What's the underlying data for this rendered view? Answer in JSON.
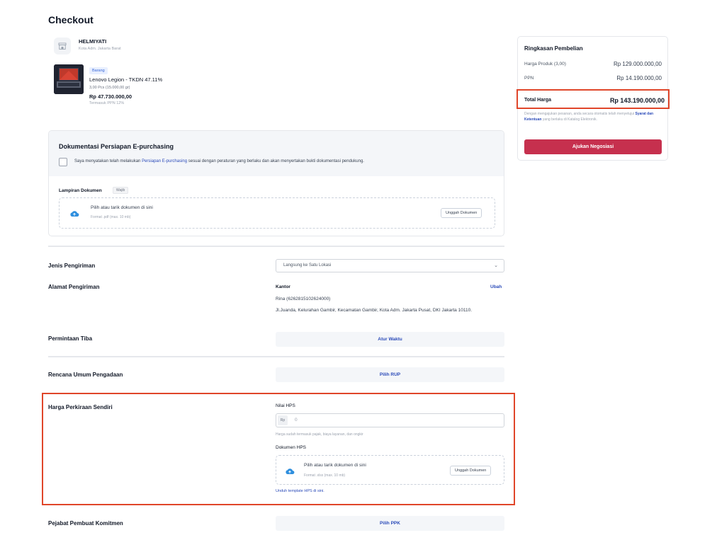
{
  "page": {
    "title": "Checkout"
  },
  "seller": {
    "name": "HELMIYATI",
    "city": "Kota Adm. Jakarta Barat",
    "icon": "store-icon"
  },
  "product": {
    "badge": "Barang",
    "name": "Lenovo Legion - TKDN 47.11%",
    "qty": "3,00 Pcs (15.000,00 gr)",
    "price": "Rp 47.730.000,00",
    "tax": "Termasuk PPN 12%"
  },
  "eproc": {
    "title": "Dokumentasi Persiapan E-purchasing",
    "check_prefix": "Saya menyatakan telah melakukan ",
    "check_link": "Persiapan E-purchasing",
    "check_suffix": " sesuai dengan peraturan yang berlaku dan akan menyertakan bukti dokumentasi pendukung.",
    "attachment_label": "Lampiran Dokumen",
    "required_badge": "Wajib",
    "dropzone_main": "Pilih atau tarik dokumen di sini",
    "dropzone_sub": "Format .pdf (max. 10 mb)",
    "upload_label": "Unggah Dokumen"
  },
  "shipping": {
    "type_label": "Jenis Pengiriman",
    "type_value": "Langsung ke Satu Lokasi",
    "address_label": "Alamat Pengiriman",
    "address_name": "Kantor",
    "address_change": "Ubah",
    "address_phone": "Rina (6262815102624000)",
    "address_line": "Jl.Juanda, Kelurahan Gambir, Kecamatan Gambir, Kota Adm. Jakarta Pusat, DKI Jakarta 10110.",
    "arrival_label": "Permintaan Tiba",
    "arrival_button": "Atur Waktu"
  },
  "rup": {
    "label": "Rencana Umum Pengadaan",
    "button": "Pilih RUP"
  },
  "hps": {
    "label": "Harga Perkiraan Sendiri",
    "value_label": "Nilai HPS",
    "currency": "Rp",
    "value": "0",
    "note": "Harga sudah termasuk pajak, biaya layanan, dan ongkir",
    "doc_label": "Dokumen HPS",
    "dropzone_main": "Pilih atau tarik dokumen di sini",
    "dropzone_sub": "Format .xlsx (max. 10 mb)",
    "upload_label": "Unggah Dokumen",
    "template_link": "Unduh template HPS di sini."
  },
  "ppk": {
    "label": "Pejabat Pembuat Komitmen",
    "button": "Pilih PPK"
  },
  "summary": {
    "title": "Ringkasan Pembelian",
    "product_label": "Harga Produk (3,00)",
    "product_value": "Rp 129.000.000,00",
    "tax_label": "PPN",
    "tax_value": "Rp 14.190.000,00",
    "total_label": "Total Harga",
    "total_value": "Rp 143.190.000,00",
    "note_prefix": "Dengan mengajukan pesanan, anda secara otomatis telah menyetujui ",
    "note_link": "Syarat dan Ketentuan",
    "note_suffix": " yang berlaku di Katalog Elektronik.",
    "button": "Ajukan Negosiasi"
  },
  "colors": {
    "accent": "#2b4bb9",
    "primary_button": "#c6304e",
    "highlight": "#e0462a"
  }
}
